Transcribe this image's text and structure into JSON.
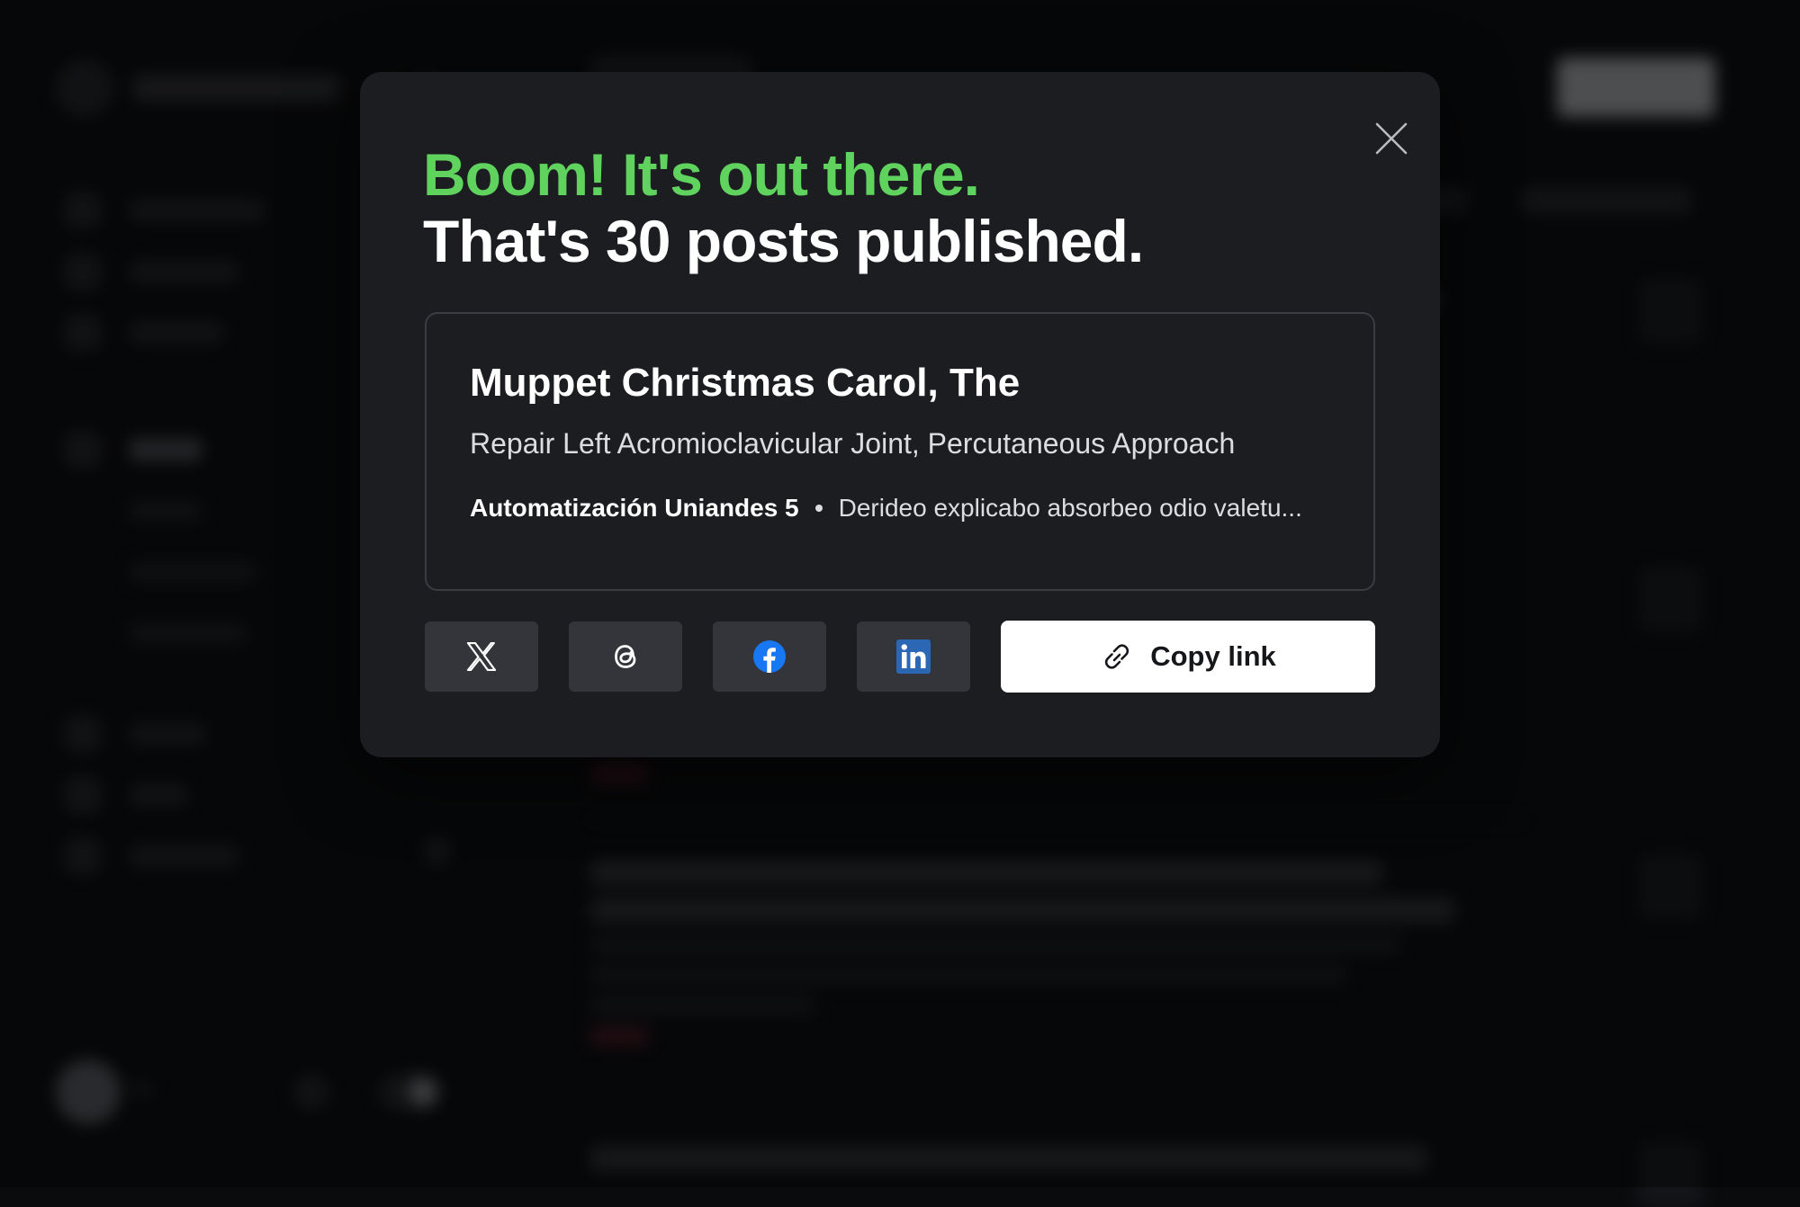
{
  "modal": {
    "heading_primary": "Boom! It's out there.",
    "heading_secondary": "That's 30 posts published.",
    "close_icon": "close-icon",
    "post": {
      "title": "Muppet Christmas Carol, The",
      "excerpt": "Repair Left Acromioclavicular Joint, Percutaneous Approach",
      "author": "Automatización Uniandes 5",
      "snippet": "Derideo explicabo absorbeo odio valetu..."
    },
    "share": {
      "buttons": [
        {
          "icon": "x-twitter-icon"
        },
        {
          "icon": "threads-icon"
        },
        {
          "icon": "facebook-icon",
          "color": "#1877f2"
        },
        {
          "icon": "linkedin-icon",
          "color": "#2c67b5"
        }
      ],
      "copy_link_label": "Copy link",
      "copy_link_icon": "link-icon"
    },
    "accent_color": "#5fd35e"
  }
}
